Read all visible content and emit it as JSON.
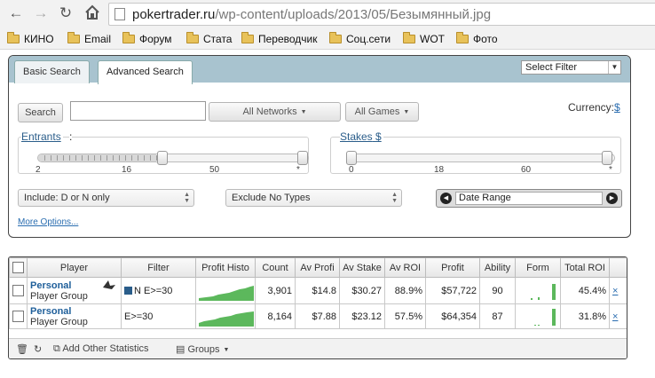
{
  "browser": {
    "url_domain": "pokertrader.ru",
    "url_path": "/wp-content/uploads/2013/05/Безымянный.jpg",
    "bookmarks": [
      "КИНО",
      "Email",
      "Форум",
      "Стата",
      "Переводчик",
      "Соц.сети",
      "WOT",
      "Фото"
    ]
  },
  "search": {
    "tabs": [
      "Basic Search",
      "Advanced Search"
    ],
    "select_filter": "Select Filter",
    "search_button": "Search",
    "search_value": "",
    "networks": "All Networks",
    "games": "All Games",
    "currency_label": "Currency:",
    "currency_value": "$",
    "entrants": {
      "title": "Entrants",
      "ticks": [
        "2",
        "16",
        "50",
        "*"
      ]
    },
    "stakes": {
      "title": "Stakes",
      "unit": "$",
      "ticks": [
        "0",
        "18",
        "60",
        "*"
      ]
    },
    "include": "Include: D or N only",
    "exclude": "Exclude No Types",
    "date_range": "Date Range",
    "more_options": "More Options..."
  },
  "table": {
    "headers": [
      "Player",
      "Filter",
      "Profit Histo",
      "Count",
      "Av Profi",
      "Av Stake",
      "Av ROI",
      "Profit",
      "Ability",
      "Form",
      "Total ROI"
    ],
    "rows": [
      {
        "name": "Personal",
        "group": "Player Group",
        "filter": "N E>=30",
        "count": "3,901",
        "av_profit": "$14.8",
        "av_stake": "$30.27",
        "av_roi": "88.9%",
        "profit": "$57,722",
        "ability": "90",
        "total_roi": "45.4%",
        "close": "×"
      },
      {
        "name": "Personal",
        "group": "Player Group",
        "filter": "E>=30",
        "count": "8,164",
        "av_profit": "$7.88",
        "av_stake": "$23.12",
        "av_roi": "57.5%",
        "profit": "$64,354",
        "ability": "87",
        "total_roi": "31.8%",
        "close": "×"
      }
    ]
  },
  "footer": {
    "add_stats": "Add Other Statistics",
    "groups": "Groups"
  },
  "colors": {
    "tab_bar": "#a8c3cf",
    "link": "#2a6db0",
    "spark": "#5cb85c"
  }
}
